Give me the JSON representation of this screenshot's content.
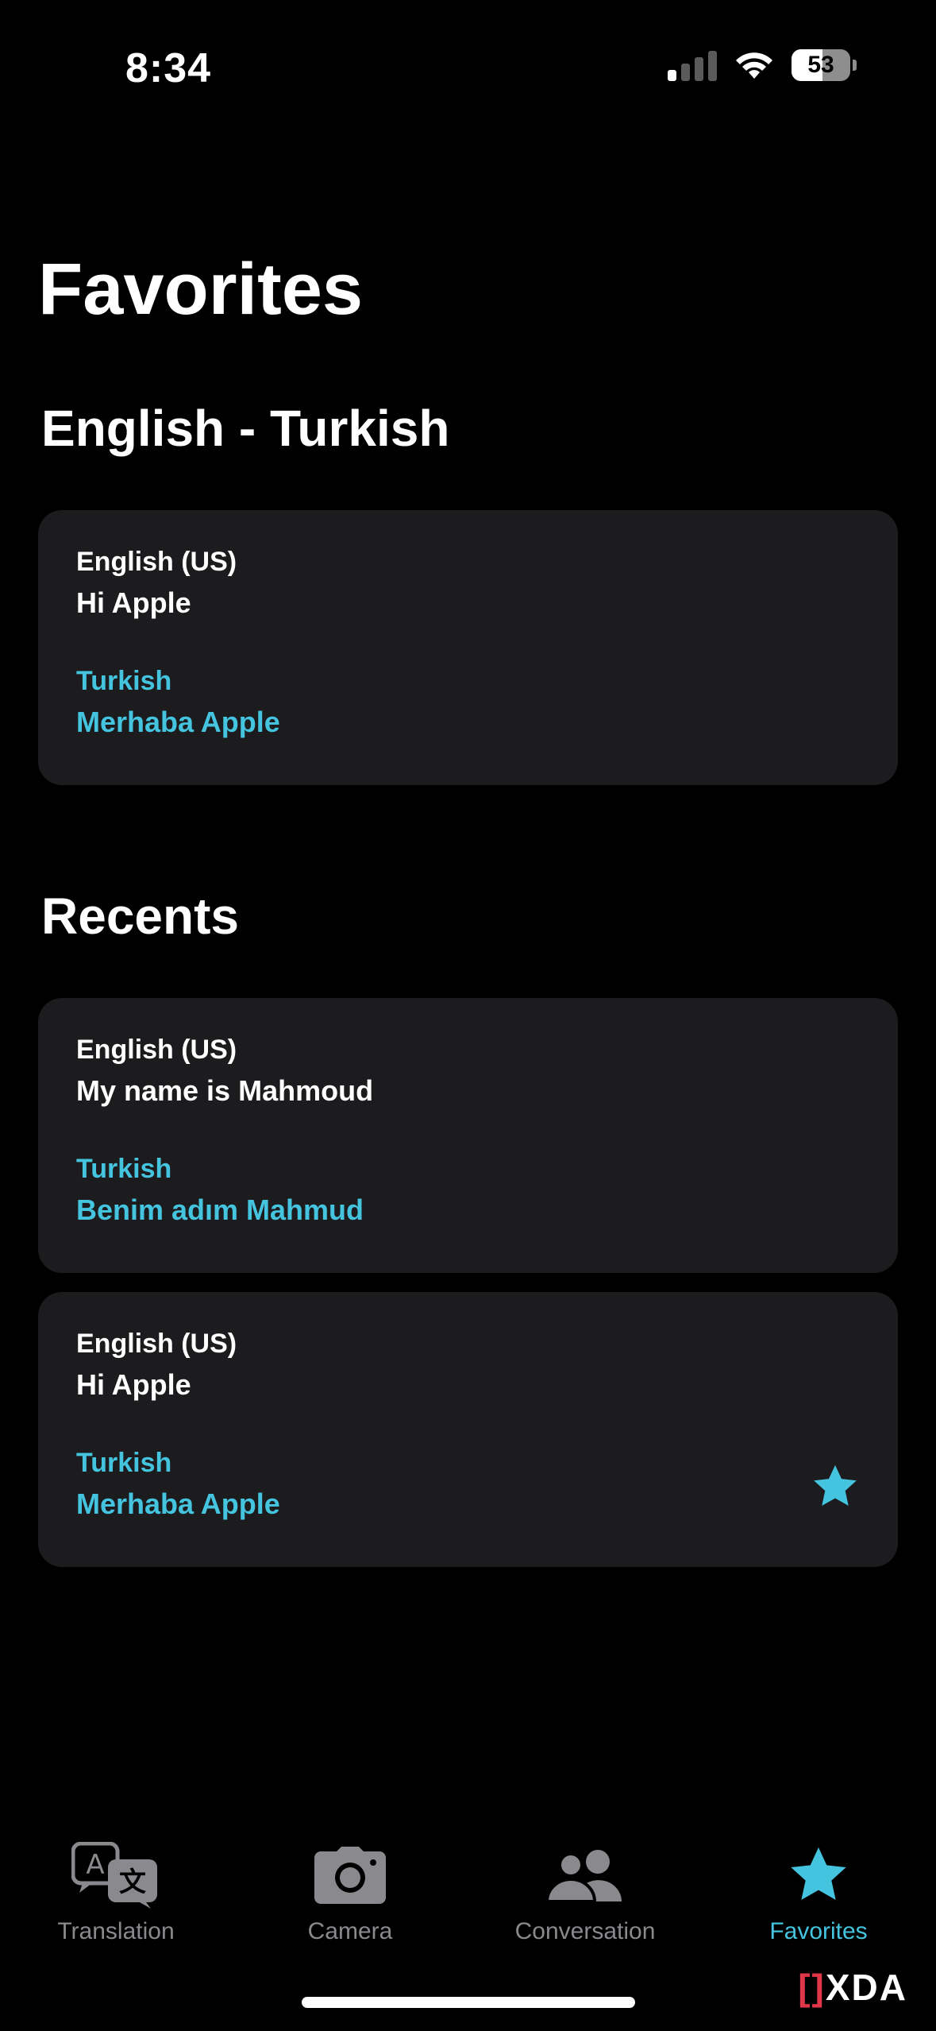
{
  "status_bar": {
    "time": "8:34",
    "battery": "53"
  },
  "page": {
    "title": "Favorites"
  },
  "favorites_section": {
    "title": "English - Turkish",
    "items": [
      {
        "source_lang": "English (US)",
        "source_text": "Hi Apple",
        "target_lang": "Turkish",
        "target_text": "Merhaba Apple"
      }
    ]
  },
  "recents_section": {
    "title": "Recents",
    "items": [
      {
        "source_lang": "English (US)",
        "source_text": "My name is Mahmoud",
        "target_lang": "Turkish",
        "target_text": "Benim adım Mahmud",
        "favorited": false
      },
      {
        "source_lang": "English (US)",
        "source_text": "Hi Apple",
        "target_lang": "Turkish",
        "target_text": "Merhaba Apple",
        "favorited": true
      }
    ]
  },
  "tabs": [
    {
      "label": "Translation",
      "icon": "translate-icon",
      "active": false
    },
    {
      "label": "Camera",
      "icon": "camera-icon",
      "active": false
    },
    {
      "label": "Conversation",
      "icon": "people-icon",
      "active": false
    },
    {
      "label": "Favorites",
      "icon": "star-icon",
      "active": true
    }
  ],
  "watermark": {
    "bracket": "[]",
    "text": "XDA"
  },
  "colors": {
    "accent": "#44c4df",
    "card_bg": "#1c1c1e",
    "inactive_tab": "#8a8a8e"
  }
}
